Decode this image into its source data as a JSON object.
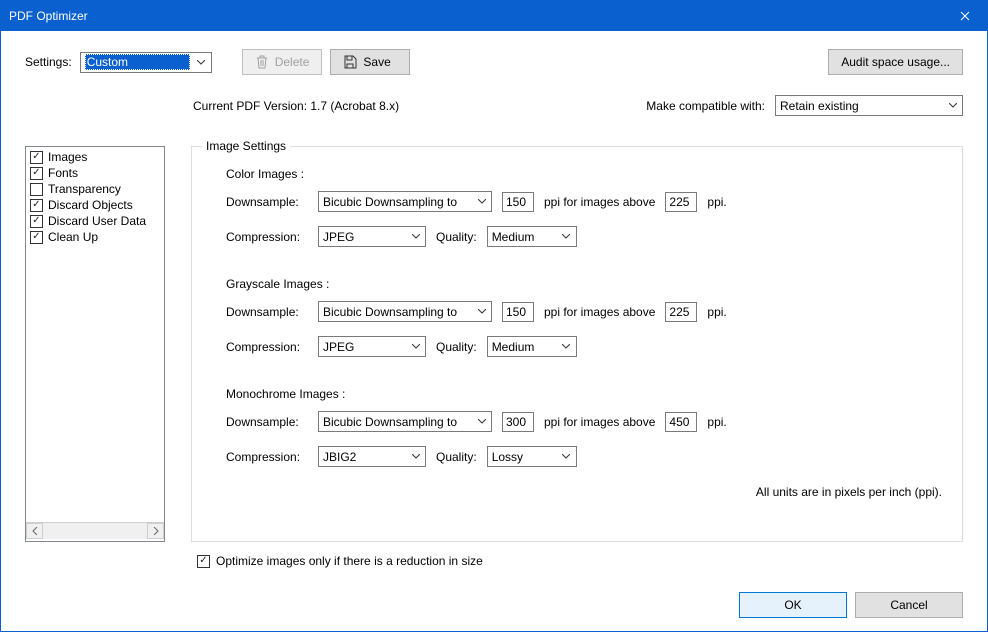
{
  "window": {
    "title": "PDF Optimizer"
  },
  "top": {
    "settings_label": "Settings:",
    "settings_value": "Custom",
    "delete_label": "Delete",
    "save_label": "Save",
    "audit_label": "Audit space usage..."
  },
  "version_row": {
    "current_label": "Current PDF Version: 1.7 (Acrobat 8.x)",
    "compat_label": "Make compatible with:",
    "compat_value": "Retain existing"
  },
  "categories": [
    {
      "label": "Images",
      "checked": true
    },
    {
      "label": "Fonts",
      "checked": true
    },
    {
      "label": "Transparency",
      "checked": false
    },
    {
      "label": "Discard Objects",
      "checked": true
    },
    {
      "label": "Discard User Data",
      "checked": true
    },
    {
      "label": "Clean Up",
      "checked": true
    }
  ],
  "group": {
    "title": "Image Settings",
    "labels": {
      "downsample": "Downsample:",
      "compression": "Compression:",
      "quality": "Quality:",
      "ppi_for_above": "ppi for images above",
      "ppi_suffix": "ppi."
    },
    "color": {
      "heading": "Color Images :",
      "downsample_method": "Bicubic Downsampling to",
      "ppi_target": "150",
      "ppi_above": "225",
      "compression": "JPEG",
      "quality": "Medium"
    },
    "gray": {
      "heading": "Grayscale Images :",
      "downsample_method": "Bicubic Downsampling to",
      "ppi_target": "150",
      "ppi_above": "225",
      "compression": "JPEG",
      "quality": "Medium"
    },
    "mono": {
      "heading": "Monochrome Images :",
      "downsample_method": "Bicubic Downsampling to",
      "ppi_target": "300",
      "ppi_above": "450",
      "compression": "JBIG2",
      "quality": "Lossy"
    },
    "units_note": "All units are in pixels per inch (ppi)."
  },
  "optimize_checkbox": {
    "label": "Optimize images only if there is a reduction in size",
    "checked": true
  },
  "footer": {
    "ok": "OK",
    "cancel": "Cancel"
  }
}
